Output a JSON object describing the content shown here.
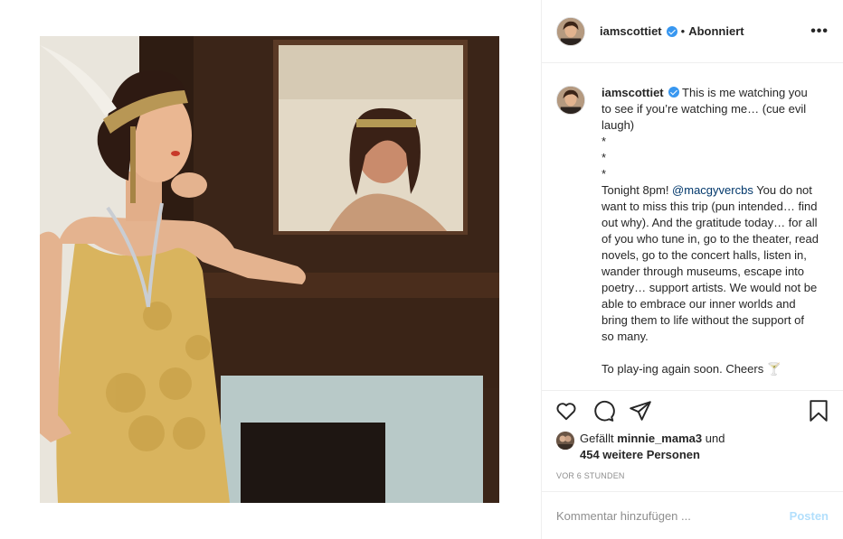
{
  "post": {
    "username": "iamscottiet",
    "follow_status": "Abonniert",
    "separator": "•",
    "more_icon": "more-horizontal-icon",
    "more_label": "•••"
  },
  "caption": {
    "username": "iamscottiet",
    "text": " This is me watching you to see if you’re watching me… (cue evil laugh)\n*\n*\n*\nTonight 8pm! ",
    "mention": "@macgyvercbs",
    "text2": " You do not want to miss this trip (pun intended… find out why). And the gratitude today… for all of you who tune in, go to the theater, read novels, go to the concert halls, listen in, wander through museums, escape into poetry… support artists. We would not be able to embrace our inner worlds and bring them to life without the support of so many.\n\nTo play-ing again soon. Cheers 🍸"
  },
  "actions": {
    "like_icon": "heart-icon",
    "comment_icon": "comment-icon",
    "share_icon": "paper-plane-icon",
    "save_icon": "bookmark-icon"
  },
  "likes": {
    "prefix": "Gefällt ",
    "liker": "minnie_mama3",
    "middle": " und ",
    "others": "454 weitere Personen"
  },
  "timestamp": "VOR 6 STUNDEN",
  "comment": {
    "placeholder": "Kommentar hinzufügen ...",
    "post_label": "Posten"
  },
  "colors": {
    "verified": "#3897f0",
    "link": "#00376b",
    "post_button_disabled": "#b2dffc",
    "muted": "#8e8e8e"
  }
}
